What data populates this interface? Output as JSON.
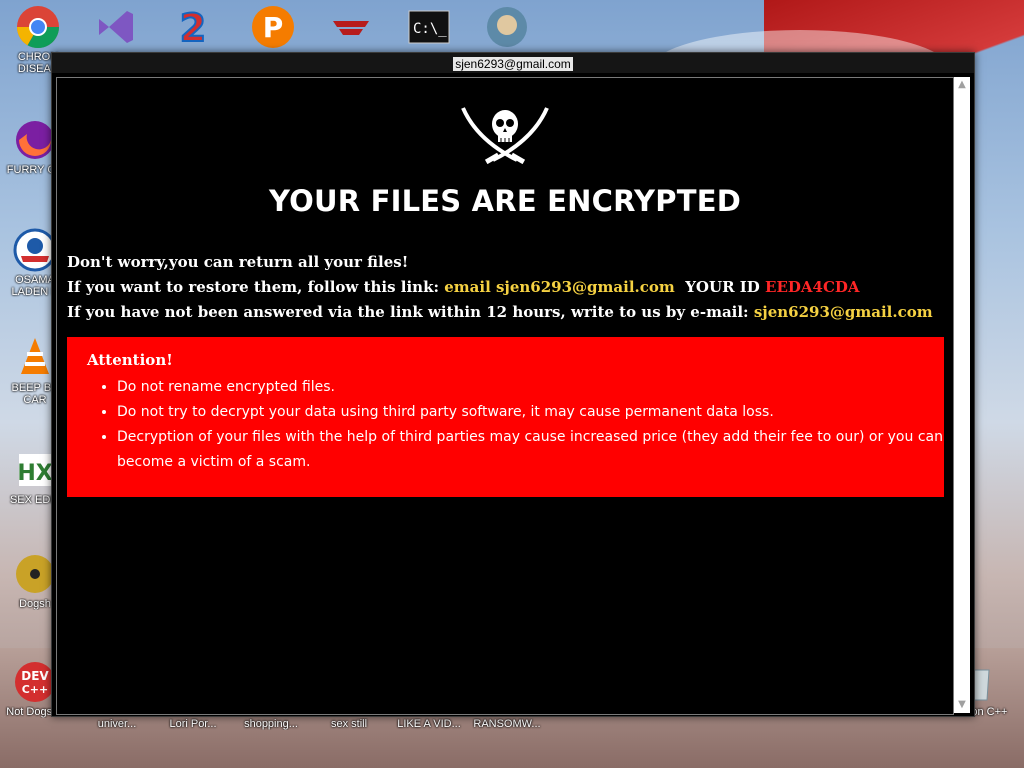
{
  "desktop": {
    "icons": [
      {
        "label": "CHRON\nDISEAS",
        "icon": "chrome-icon"
      },
      {
        "label": "FURRY CU",
        "icon": "firefox-icon"
      },
      {
        "label": "OSAMA\nLADEN E",
        "icon": "obama-icon"
      },
      {
        "label": "BEEP BE\nCAR",
        "icon": "vlc-icon"
      },
      {
        "label": "SEX EDIT",
        "icon": "hex-editor-icon"
      },
      {
        "label": "Dogsh",
        "icon": "disc-icon"
      },
      {
        "label": "Not Dogshit",
        "icon": "dev-cpp-icon"
      },
      {
        "label": "Falcon C++",
        "icon": "recycle-bin-icon"
      }
    ],
    "bottom_labels": [
      "univer...",
      "Lori Por...",
      "shopping...",
      "sex still",
      "LIKE A VID...",
      "RANSOMW..."
    ]
  },
  "window": {
    "title": "sjen6293@gmail.com"
  },
  "note": {
    "headline": "YOUR FILES ARE ENCRYPTED",
    "line1": "Don't worry,you can return all your files!",
    "line2_prefix": "If you want to restore them, follow this link: ",
    "line2_link": "email sjen6293@gmail.com",
    "line2_id_label": "YOUR ID",
    "line2_id": "EEDA4CDA",
    "line3_prefix": "If you have not been answered via the link within 12 hours, write to us by e-mail: ",
    "line3_email": "sjen6293@gmail.com",
    "attention_title": "Attention!",
    "attention_items": [
      "Do not rename encrypted files.",
      "Do not try to decrypt your data using third party software, it may cause permanent data loss.",
      "Decryption of your files with the help of third parties may cause increased price (they add their fee to our) or you can become a victim of a scam."
    ]
  },
  "colors": {
    "accent_yellow": "#f5d142",
    "id_red": "#ff2626",
    "attention_bg": "#ff0000"
  }
}
